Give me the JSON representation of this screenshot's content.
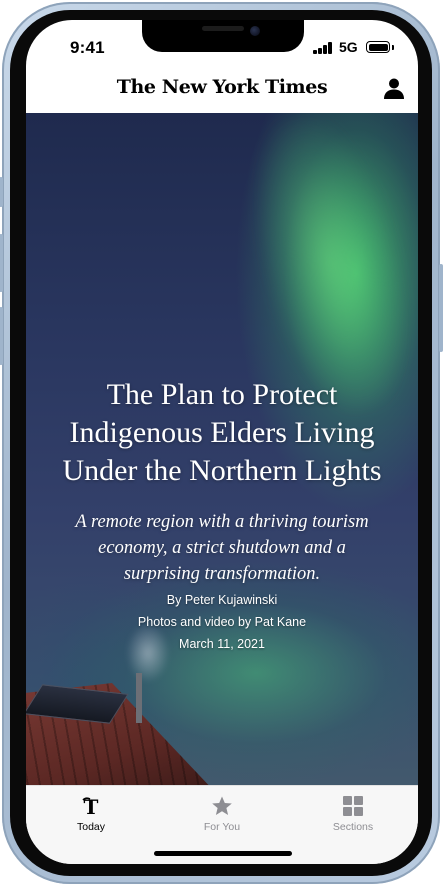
{
  "status_bar": {
    "time": "9:41",
    "network": "5G"
  },
  "header": {
    "masthead": "The New York Times",
    "account_icon": "person-icon"
  },
  "article": {
    "headline": "The Plan to Protect Indigenous Elders Living Under the Northern Lights",
    "summary": "A remote region with a thriving tourism economy, a strict shutdown and a surprising transformation.",
    "byline": "By Peter Kujawinski",
    "credit": "Photos and video by Pat Kane",
    "date": "March 11, 2021"
  },
  "tabs": [
    {
      "label": "Today",
      "icon": "nyt-t-logo-icon",
      "selected": true
    },
    {
      "label": "For You",
      "icon": "star-icon",
      "selected": false
    },
    {
      "label": "Sections",
      "icon": "grid-icon",
      "selected": false
    }
  ],
  "colors": {
    "tab_selected": "#000000",
    "tab_unselected": "#8e8e93",
    "tab_bar_bg": "#f7f7f7",
    "sky_top": "#1f2a4e",
    "aurora_green": "#46c86e"
  }
}
